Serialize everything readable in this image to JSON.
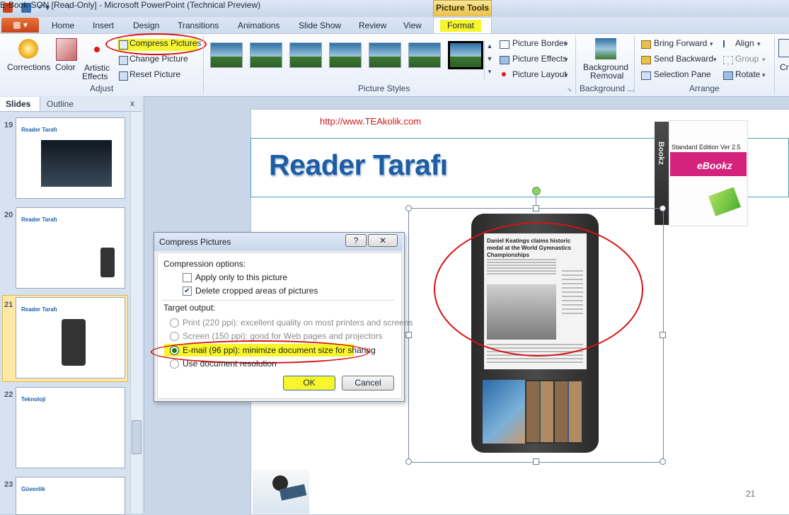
{
  "titlebar": {
    "title": "E-Book-SON [Read-Only]  -  Microsoft PowerPoint (Technical Preview)",
    "contextual_tab": "Picture Tools"
  },
  "tabs": {
    "file": "",
    "items": [
      "Home",
      "Insert",
      "Design",
      "Transitions",
      "Animations",
      "Slide Show",
      "Review",
      "View"
    ],
    "format": "Format"
  },
  "ribbon": {
    "adjust": {
      "corrections": "Corrections",
      "color": "Color",
      "artistic1": "Artistic",
      "artistic2": "Effects",
      "compress": "Compress Pictures",
      "change": "Change Picture",
      "reset": "Reset Picture",
      "label": "Adjust"
    },
    "styles": {
      "label": "Picture Styles",
      "border": "Picture Border",
      "effects": "Picture Effects",
      "layout": "Picture Layout"
    },
    "background": {
      "label1": "Background",
      "label2": "Removal",
      "group": "Background ..."
    },
    "arrange": {
      "bring": "Bring Forward",
      "send": "Send Backward",
      "selection": "Selection Pane",
      "align": "Align",
      "group": "Group",
      "rotate": "Rotate",
      "label": "Arrange"
    },
    "crop_partial": "Cr"
  },
  "leftpane": {
    "tab_slides": "Slides",
    "tab_outline": "Outline",
    "close": "x",
    "slides": [
      {
        "num": "19",
        "title": "Reader Tarafı"
      },
      {
        "num": "20",
        "title": "Reader Tarafı"
      },
      {
        "num": "21",
        "title": "Reader Tarafı"
      },
      {
        "num": "22",
        "title": "Teknoloji"
      },
      {
        "num": "23",
        "title": "Güvenlik"
      }
    ]
  },
  "slide": {
    "url": "http://www.TEAkolik.com",
    "title": "Reader Tarafı",
    "page_number": "21",
    "ebook_box": {
      "edition": "Standard Edition Ver 2.5",
      "brand": "eBookz",
      "side": "Bookz"
    },
    "reader_screen": {
      "headline": "Daniel Keatings claims historic medal at the World Gymnastics Championships"
    }
  },
  "dialog": {
    "title": "Compress Pictures",
    "help": "?",
    "close": "✕",
    "compression_heading": "Compression options:",
    "apply_only": "Apply only to this picture",
    "delete_cropped": "Delete cropped areas of pictures",
    "target_heading": "Target output:",
    "print": "Print (220 ppi): excellent quality on most printers and screens",
    "screen": "Screen (150 ppi): good for Web pages and projectors",
    "email": "E-mail (96 ppi): minimize document size for sharing",
    "use_doc": "Use document resolution",
    "ok": "OK",
    "cancel": "Cancel"
  },
  "colors": {
    "highlight": "#f7f52c",
    "annotation_red": "#d51212",
    "title_blue": "#1e5ca3"
  }
}
